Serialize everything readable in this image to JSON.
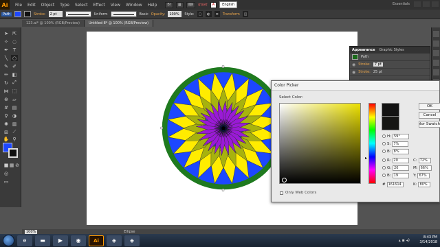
{
  "menubar": {
    "logo": "Ai",
    "items": [
      "File",
      "Edit",
      "Object",
      "Type",
      "Select",
      "Effect",
      "View",
      "Window",
      "Help"
    ],
    "language": "English",
    "bangla_label": "বাংলা",
    "workspace": "Essentials"
  },
  "controlbar": {
    "object_type": "Path",
    "stroke_label": "Stroke:",
    "stroke_weight": "2 pt",
    "profile_uniform": "Uniform",
    "brush_basic": "Basic",
    "opacity_label": "Opacity:",
    "opacity_value": "100%",
    "style_label": "Style:",
    "transform_label": "Transform"
  },
  "tabs": [
    {
      "label": "123.ai* @ 100% (RGB/Preview)"
    },
    {
      "label": "Untitled-8* @ 100% (RGB/Preview)"
    }
  ],
  "appearance": {
    "tab_appearance": "Appearance",
    "tab_graphic_styles": "Graphic Styles",
    "path_label": "Path",
    "stroke_label": "Stroke:",
    "stroke_weight": "7 pt",
    "stroke_label_2": "Stroke:",
    "stroke_weight_2": "25 pt"
  },
  "picker": {
    "title": "Color Picker",
    "select_label": "Select Color:",
    "ok": "OK",
    "cancel": "Cancel",
    "color_swatches": "Color Swatches",
    "web_only": "Only Web Colors",
    "h": "59°",
    "s": "7%",
    "b": "8%",
    "r": "20",
    "g": "20",
    "bb": "19",
    "hex": "161614",
    "c": "72%",
    "m": "66%",
    "y": "67%",
    "k": "80%"
  },
  "status": {
    "zoom": "100%",
    "tool": "Ellipse"
  },
  "taskbar": {
    "time": "8:43 PM",
    "date": "3/14/2018"
  },
  "colors": {
    "blue_fill": "#1d47ff",
    "green_ring": "#1f7a1f",
    "yellow_petals": "#ffec00",
    "olive_petals": "#a7b20e",
    "purple_center": "#9a1ad6"
  }
}
